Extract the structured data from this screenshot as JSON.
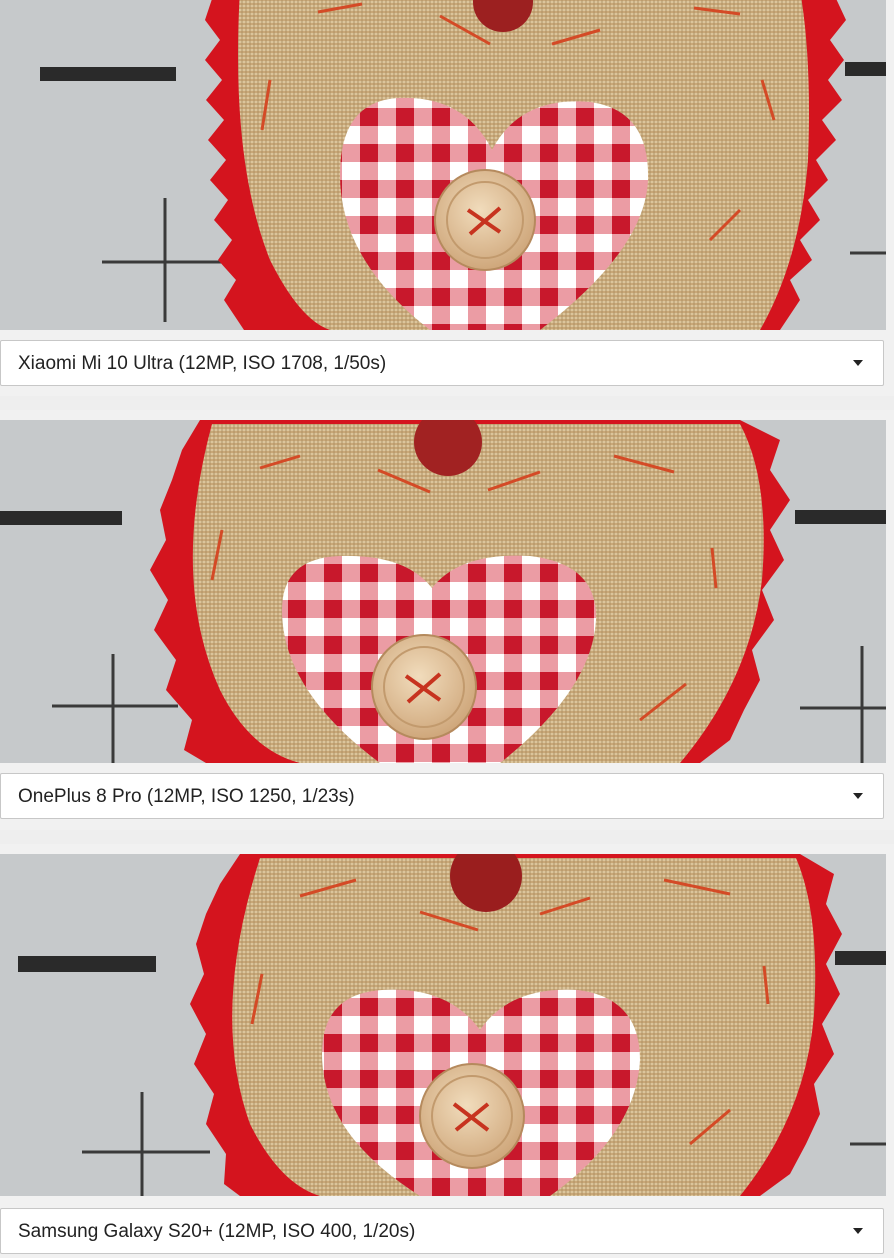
{
  "comparisons": [
    {
      "selected_option": "Xiaomi Mi 10 Ultra (12MP, ISO 1708, 1/50s)",
      "image_icon": "burlap-heart-photo"
    },
    {
      "selected_option": "OnePlus 8 Pro (12MP, ISO 1250, 1/23s)",
      "image_icon": "burlap-heart-photo"
    },
    {
      "selected_option": "Samsung Galaxy S20+ (12MP, ISO 400, 1/20s)",
      "image_icon": "burlap-heart-photo"
    }
  ],
  "icons": {
    "dropdown": "chevron-down-icon"
  },
  "colors": {
    "burlap": "#c9a878",
    "gingham_red": "#c8182c",
    "zigzag_red": "#d4141e",
    "button_wood": "#e0bf96",
    "background_gray": "#c9ccce"
  }
}
